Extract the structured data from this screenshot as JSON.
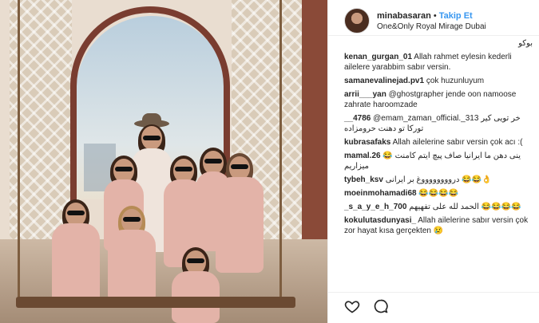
{
  "header": {
    "username": "minabasaran",
    "separator": "•",
    "follow_label": "Takip Et",
    "location": "One&Only Royal Mirage Dubai"
  },
  "comments": [
    {
      "user": "",
      "text": "بوکو"
    },
    {
      "user": "kenan_gurgan_01",
      "text": "Allah rahmet eylesin kederli ailelere yarabbim sabır versin."
    },
    {
      "user": "samanevalinejad.pv1",
      "text": "çok huzunluyum"
    },
    {
      "user": "arrii___yan",
      "text": "@ghostgrapher jende oon namoose zahrate haroomzade"
    },
    {
      "user": "__4786",
      "text": "@emam_zaman_official._313 خر تویی کیر تورکا تو دهنت حرومزاده"
    },
    {
      "user": "kubrasafaks",
      "text": "Allah ailelerine sabır versin çok acı :("
    },
    {
      "user": "mamal.26",
      "text": "ینی دهن ما ایرانیا صاف پیچ ایتم کامنت 😂 میزاریم"
    },
    {
      "user": "tybeh_ksv",
      "text": "درووووووووغ بر ایرانی 😂😂👌"
    },
    {
      "user": "moeinmohamadi68",
      "text": "😂😂😂😂"
    },
    {
      "user": "_s_a_y_e_h_700",
      "text": "الحمد لله علی تفهیهم 😂😂😂😂"
    },
    {
      "user": "kokulutasdunyasi_",
      "text": "Allah ailelerine sabır versin çok zor hayat kısa gerçekten 😢"
    }
  ],
  "icons": {
    "like": "heart-icon",
    "comment": "comment-icon"
  }
}
